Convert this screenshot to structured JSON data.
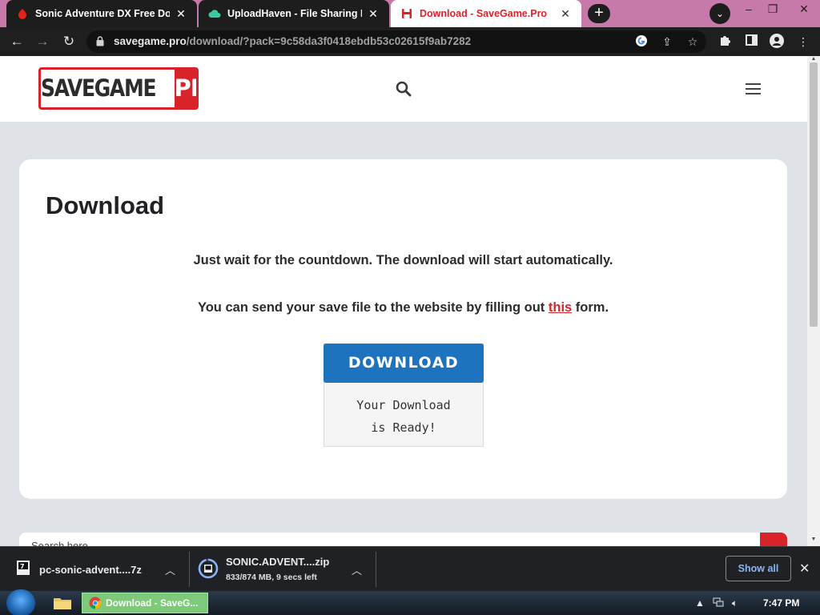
{
  "browser": {
    "tabs": [
      {
        "title": "Sonic Adventure DX Free Download",
        "active": false
      },
      {
        "title": "UploadHaven - File Sharing Made Simple",
        "active": false
      },
      {
        "title": "Download - SaveGame.Pro",
        "active": true
      }
    ],
    "new_tab_label": "+",
    "close_glyph": "✕",
    "url_host": "savegame.pro",
    "url_path": "/download/?pack=9c58da3f0418ebdb53c02615f9ab7282"
  },
  "site": {
    "logo_left": "SAVEGAME",
    "logo_right": "PRO"
  },
  "page": {
    "title": "Download",
    "message_wait": "Just wait for the countdown. The download will start automatically.",
    "message_send_prefix": "You can send your save file to the website by filling out ",
    "message_send_link": "this",
    "message_send_suffix": " form.",
    "download_button": "DOWNLOAD",
    "ready_line1": "Your Download",
    "ready_line2": "is Ready!",
    "search_placeholder": "Search here..."
  },
  "downloads": {
    "items": [
      {
        "name": "pc-sonic-advent....7z",
        "status": ""
      },
      {
        "name": "SONIC.ADVENT....zip",
        "status": "833/874 MB, 9 secs left"
      }
    ],
    "show_all": "Show all"
  },
  "taskbar": {
    "active_window": "Download - SaveG...",
    "clock": "7:47 PM"
  },
  "colors": {
    "brand_red": "#d9232a",
    "download_blue": "#1e73be",
    "tab_strip": "#c77aa9"
  }
}
